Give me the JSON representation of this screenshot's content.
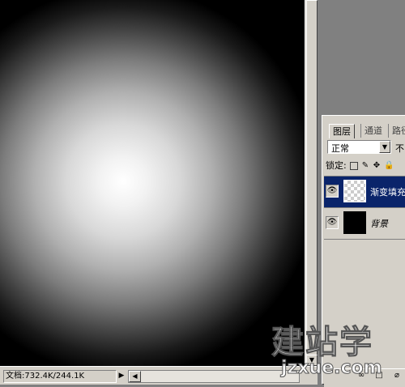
{
  "status": {
    "doc_info": "文档:732.4K/244.1K",
    "play_icon": "play-arrow-icon",
    "left_arrow": "◀"
  },
  "layers_panel": {
    "tabs": [
      "图层",
      "通道",
      "路径"
    ],
    "blend_mode": "正常",
    "opacity_label": "不",
    "lock_label": "锁定:",
    "lock_icons": [
      "lock-transparent-icon",
      "lock-paint-icon",
      "lock-move-icon",
      "lock-all-icon"
    ],
    "layers": [
      {
        "name": "渐变填充",
        "selected": true,
        "visible": true,
        "thumb": "transparent"
      },
      {
        "name": "背景",
        "selected": false,
        "visible": true,
        "thumb": "black"
      }
    ]
  },
  "canvas": {
    "gradient": "radial white-to-black"
  },
  "watermark": {
    "line1": "建站学",
    "line2": "jzxue.com"
  }
}
